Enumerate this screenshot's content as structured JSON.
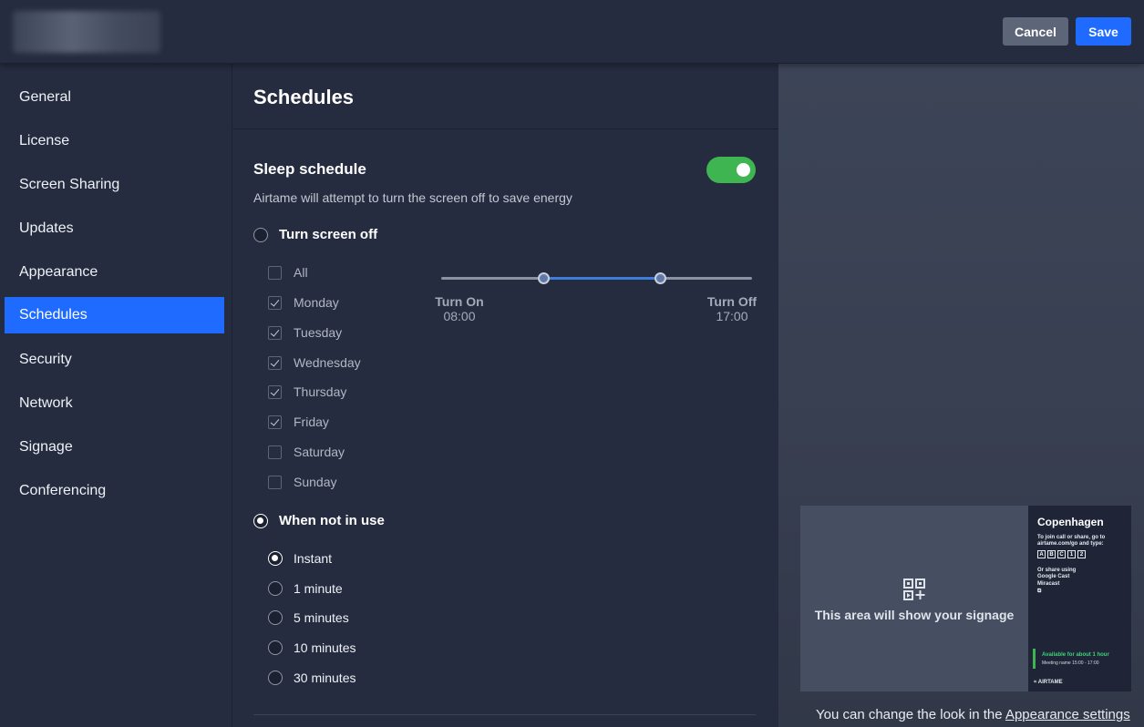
{
  "header": {
    "cancel_label": "Cancel",
    "save_label": "Save"
  },
  "sidebar": {
    "items": [
      {
        "label": "General"
      },
      {
        "label": "License"
      },
      {
        "label": "Screen Sharing"
      },
      {
        "label": "Updates"
      },
      {
        "label": "Appearance"
      },
      {
        "label": "Schedules",
        "active": true
      },
      {
        "label": "Security"
      },
      {
        "label": "Network"
      },
      {
        "label": "Signage"
      },
      {
        "label": "Conferencing"
      }
    ]
  },
  "main": {
    "title": "Schedules",
    "sleep": {
      "title": "Sleep schedule",
      "enabled": true,
      "description": "Airtame will attempt to turn the screen off to save energy",
      "mode_off_label": "Turn screen off",
      "days": [
        {
          "label": "All",
          "checked": false
        },
        {
          "label": "Monday",
          "checked": true
        },
        {
          "label": "Tuesday",
          "checked": true
        },
        {
          "label": "Wednesday",
          "checked": true
        },
        {
          "label": "Thursday",
          "checked": true
        },
        {
          "label": "Friday",
          "checked": true
        },
        {
          "label": "Saturday",
          "checked": false
        },
        {
          "label": "Sunday",
          "checked": false
        }
      ],
      "slider": {
        "on_label": "Turn On",
        "on_time": "08:00",
        "off_label": "Turn Off",
        "off_time": "17:00"
      },
      "mode_idle_label": "When not in use",
      "idle_options": [
        {
          "label": "Instant",
          "selected": true
        },
        {
          "label": "1 minute",
          "selected": false
        },
        {
          "label": "5 minutes",
          "selected": false
        },
        {
          "label": "10 minutes",
          "selected": false
        },
        {
          "label": "30 minutes",
          "selected": false
        }
      ]
    }
  },
  "preview": {
    "signage_text": "This area will show your signage",
    "city": "Copenhagen",
    "join_text_1": "To join call or share, go to",
    "join_text_2": "airtame.com/go and type:",
    "codes": [
      "A",
      "B",
      "C",
      "1",
      "2"
    ],
    "share_using": "Or share using",
    "google_cast": "Google Cast",
    "miracast": "Miracast",
    "available": "Available for about 1 hour",
    "meeting": "Meeting name 15:00 - 17:00",
    "brand": "AIRTAME",
    "footnote_text": "You can change the look in the ",
    "footnote_link": "Appearance settings"
  },
  "colors": {
    "accent": "#1f6bff",
    "toggle_on": "#3fb551",
    "background": "#252c3f"
  }
}
